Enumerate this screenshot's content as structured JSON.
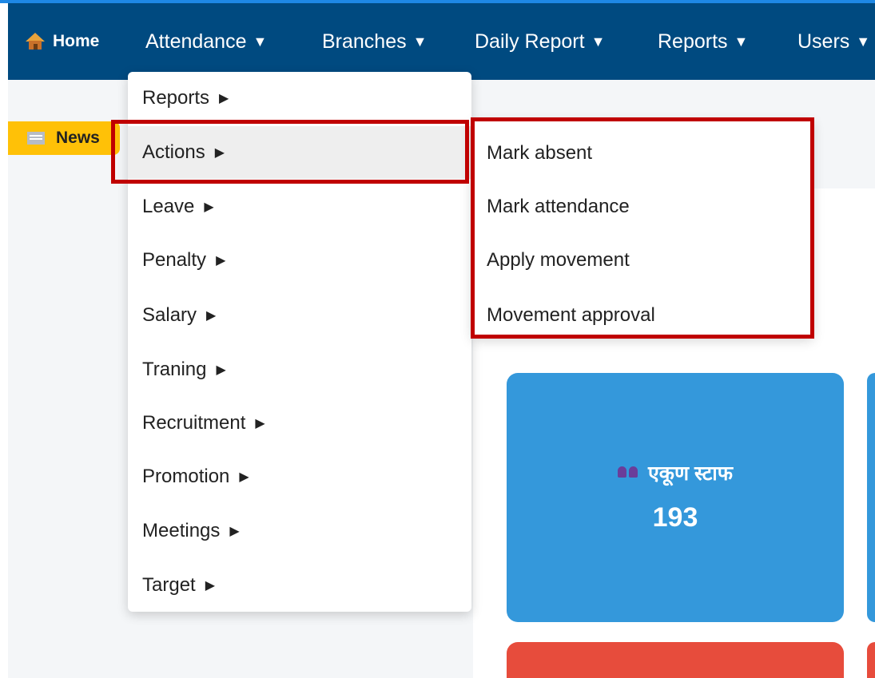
{
  "navbar": {
    "home": "Home",
    "attendance": "Attendance",
    "branches": "Branches",
    "daily_report": "Daily Report",
    "reports": "Reports",
    "users": "Users",
    "caret": "▼"
  },
  "news": {
    "label": "News"
  },
  "attendance_menu": {
    "arrow": "▶",
    "items": [
      "Reports",
      "Actions",
      "Leave",
      "Penalty",
      "Salary",
      "Traning",
      "Recruitment",
      "Promotion",
      "Meetings",
      "Target"
    ],
    "active": "Actions"
  },
  "actions_submenu": {
    "items": [
      "Mark absent",
      "Mark attendance",
      "Apply movement",
      "Movement approval"
    ]
  },
  "stats": {
    "total_staff_label": "एकूण स्टाफ",
    "total_staff_value": "193"
  },
  "colors": {
    "navbar": "#004a80",
    "news_badge": "#ffc107",
    "highlight": "#c00000",
    "card_blue": "#3498db",
    "card_red": "#e74c3c"
  },
  "icons": {
    "home": "home-icon",
    "news": "news-icon",
    "staff": "staff-icon"
  }
}
